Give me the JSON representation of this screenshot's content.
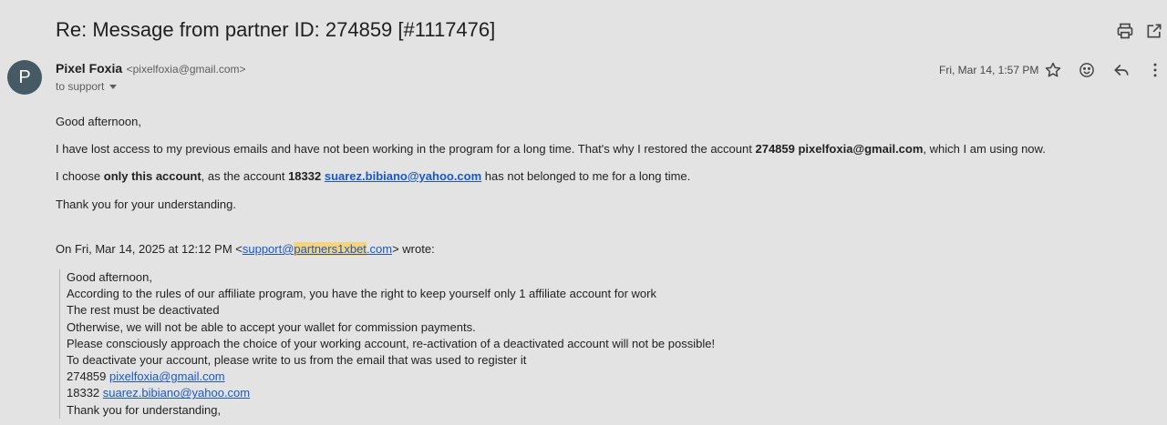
{
  "email": {
    "subject": "Re: Message from partner ID: 274859 [#1117476]",
    "sender": {
      "avatar_letter": "P",
      "avatar_color": "#455a64",
      "name": "Pixel Foxia",
      "email": "<pixelfoxia@gmail.com>"
    },
    "to_label": "to support",
    "date": "Fri, Mar 14, 1:57 PM",
    "body": {
      "greeting": "Good afternoon,",
      "p1": {
        "pre": "I have lost access to my previous emails and have not been working in the program for a long time. That's why I restored the account ",
        "bold": "274859 pixelfoxia@gmail.com",
        "post": ", which I am using now."
      },
      "p2": {
        "pre": "I choose ",
        "bold1": "only this account",
        "mid": ", as the account ",
        "bold2": "18332 ",
        "link": "suarez.bibiano@yahoo.com",
        "post": " has not belonged to me for a long time."
      },
      "p3": "Thank you for your understanding."
    },
    "quote_header": {
      "pre": "On Fri, Mar 14, 2025 at 12:12 PM <",
      "link_a": "support@",
      "link_highlight": "partners1xbet",
      "link_b": ".com",
      "post": "> wrote:"
    },
    "quoted": {
      "l1": "Good afternoon,",
      "l2": "According to the rules of our affiliate program, you have the right to keep yourself only 1 affiliate account for work",
      "l3": "The rest must be deactivated",
      "l4": "Otherwise, we will not be able to accept your wallet for commission payments.",
      "l5": "Please consciously approach the choice of your working account, re-activation of a deactivated account will not be possible!",
      "l6": "To deactivate your account, please write to us from the email that was used to register it",
      "l7_id": "274859 ",
      "l7_link": "pixelfoxia@gmail.com",
      "l8_id": "18332 ",
      "l8_link": "suarez.bibiano@yahoo.com",
      "l9": "Thank you for understanding,"
    }
  },
  "icons": {
    "print": "print-icon",
    "open_new_window": "open-in-new-window-icon",
    "star": "star-icon",
    "emoji": "add-reaction-icon",
    "reply": "reply-icon",
    "more": "more-vert-icon"
  },
  "colors": {
    "background": "#e3e3e3",
    "link": "#1a57c9",
    "highlight": "#f7d37a"
  }
}
